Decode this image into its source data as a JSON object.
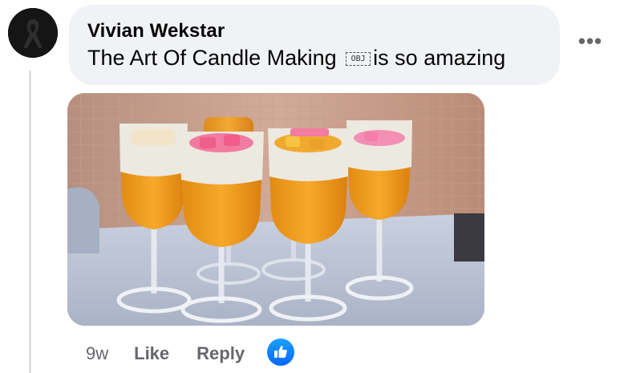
{
  "comment": {
    "author": "Vivian Wekstar",
    "text_before": "The Art Of Candle Making",
    "glyph": "OBJ",
    "text_after": "is so amazing"
  },
  "actions": {
    "time": "9w",
    "like": "Like",
    "reply": "Reply"
  },
  "icons": {
    "more": "more-options-icon",
    "reaction": "thumbs-up-icon",
    "avatar": "black-ribbon-icon"
  },
  "colors": {
    "bubble": "#f0f2f5",
    "secondary_text": "#65676b",
    "like_blue": "#0866ff"
  }
}
